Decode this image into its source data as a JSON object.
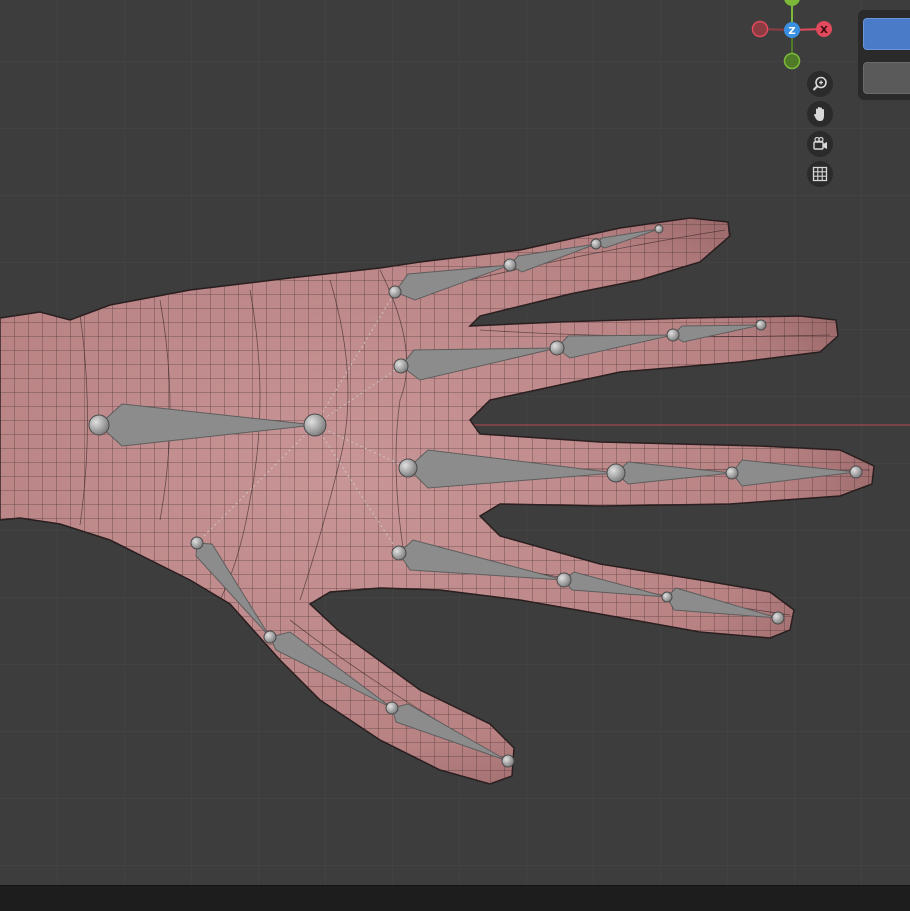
{
  "viewport": {
    "background": "#3d3d3d",
    "grid_color": "#484848",
    "x_axis_color": "#a34a4e",
    "mesh_fill": "#c69091",
    "mesh_wire": "#2a1e1f",
    "bone_color": "#8c8c8c",
    "joint_color": "#9a9a9a"
  },
  "gizmo": {
    "z_label": "Z",
    "x_label": "X",
    "colors": {
      "x": "#e04a5c",
      "x_neg": "#8c3d44",
      "y": "#7cb83a",
      "y_neg": "#4f7a28",
      "z": "#3b8fe0"
    }
  },
  "nav_buttons": [
    {
      "icon": "zoom-icon",
      "tooltip": ""
    },
    {
      "icon": "hand-pan-icon",
      "tooltip": ""
    },
    {
      "icon": "camera-view-icon",
      "tooltip": ""
    },
    {
      "icon": "grid-perspective-icon",
      "tooltip": ""
    }
  ],
  "side_panel": {
    "active_color": "#4a7bc8",
    "inactive_color": "#5a5a5a"
  },
  "status_bar": {
    "color": "#1d1d1d"
  }
}
